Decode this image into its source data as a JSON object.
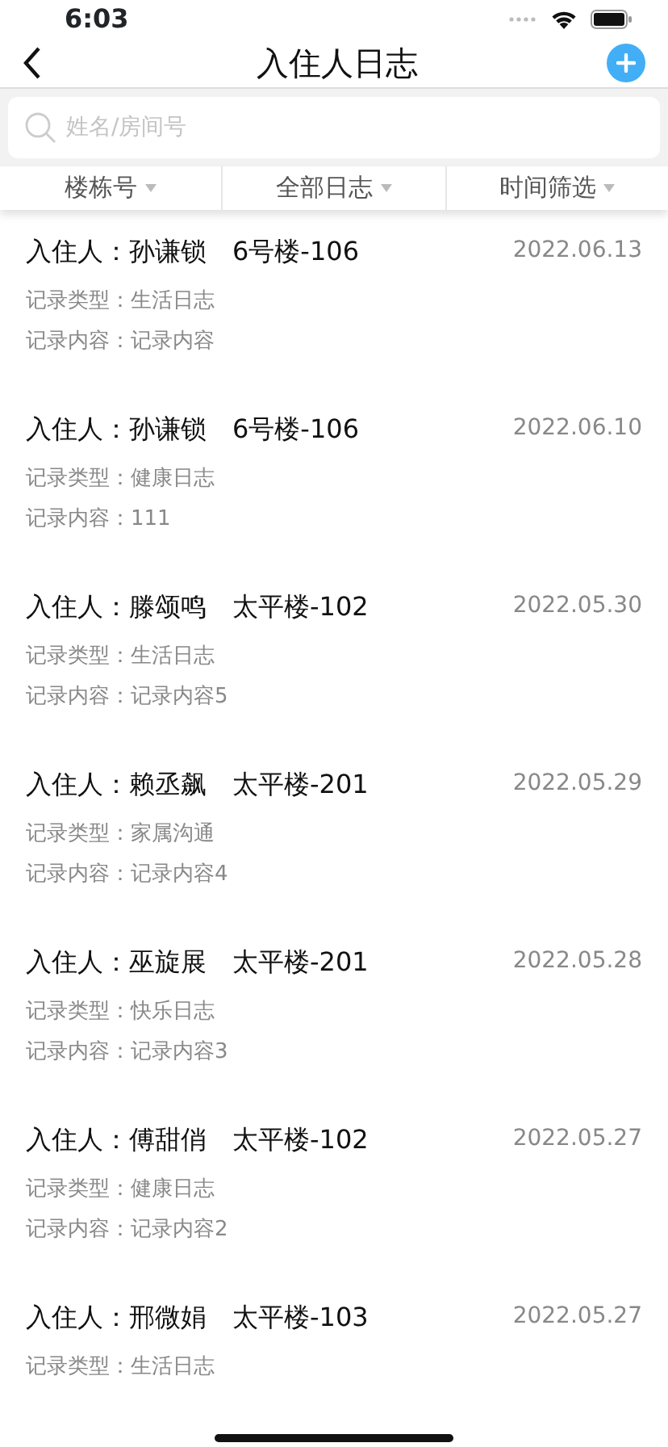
{
  "status_bar": {
    "time": "6:03"
  },
  "nav": {
    "title": "入住人日志"
  },
  "search": {
    "placeholder": "姓名/房间号"
  },
  "filters": [
    {
      "label": "楼栋号"
    },
    {
      "label": "全部日志"
    },
    {
      "label": "时间筛选"
    }
  ],
  "logs": [
    {
      "resident": "入住人：孙谦锁",
      "room": "6号楼-106",
      "date": "2022.06.13",
      "type": "记录类型：生活日志",
      "content": "记录内容：记录内容"
    },
    {
      "resident": "入住人：孙谦锁",
      "room": "6号楼-106",
      "date": "2022.06.10",
      "type": "记录类型：健康日志",
      "content": "记录内容：111"
    },
    {
      "resident": "入住人：滕颂鸣",
      "room": "太平楼-102",
      "date": "2022.05.30",
      "type": "记录类型：生活日志",
      "content": "记录内容：记录内容5"
    },
    {
      "resident": "入住人：赖丞飙",
      "room": "太平楼-201",
      "date": "2022.05.29",
      "type": "记录类型：家属沟通",
      "content": "记录内容：记录内容4"
    },
    {
      "resident": "入住人：巫旋展",
      "room": "太平楼-201",
      "date": "2022.05.28",
      "type": "记录类型：快乐日志",
      "content": "记录内容：记录内容3"
    },
    {
      "resident": "入住人：傅甜俏",
      "room": "太平楼-102",
      "date": "2022.05.27",
      "type": "记录类型：健康日志",
      "content": "记录内容：记录内容2"
    },
    {
      "resident": "入住人：邢微娟",
      "room": "太平楼-103",
      "date": "2022.05.27",
      "type": "记录类型：生活日志"
    }
  ]
}
